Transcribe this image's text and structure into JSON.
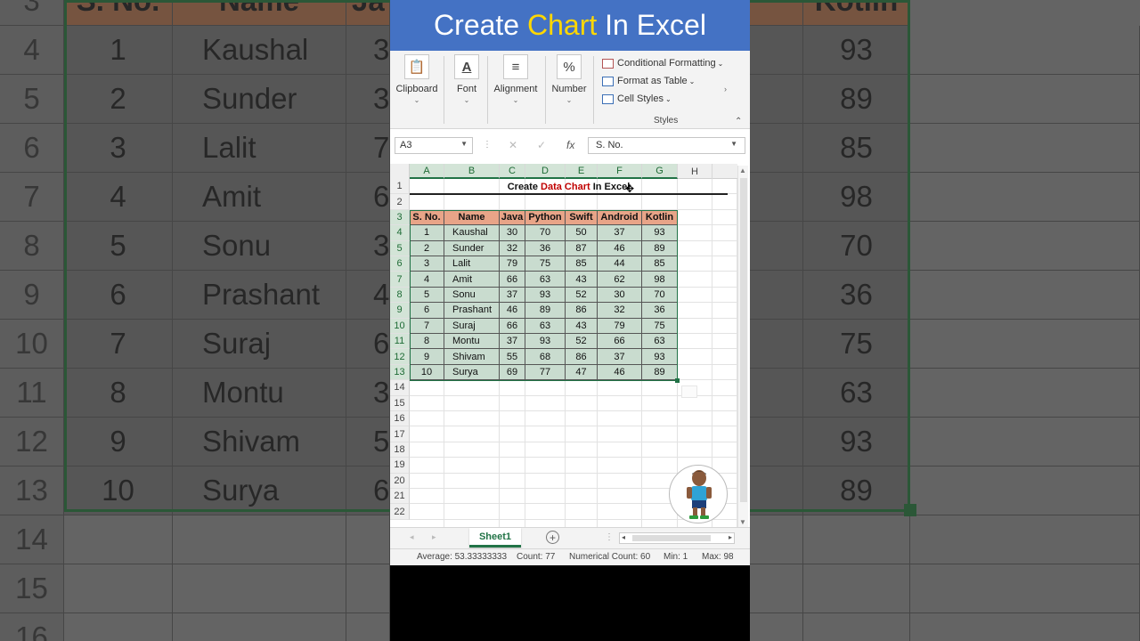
{
  "banner": {
    "prefix": "Create ",
    "highlight": "Chart",
    "suffix": " In Excel"
  },
  "ribbon": {
    "groups": [
      {
        "label": "Clipboard",
        "icon": "clipboard-icon"
      },
      {
        "label": "Font",
        "icon": "font-color-icon"
      },
      {
        "label": "Alignment",
        "icon": "align-icon"
      },
      {
        "label": "Number",
        "icon": "percent-icon"
      }
    ],
    "styles": {
      "conditional_formatting": "Conditional Formatting",
      "format_as_table": "Format as Table",
      "cell_styles": "Cell Styles",
      "group_label": "Styles"
    }
  },
  "formula_bar": {
    "name_box": "A3",
    "content": "S. No."
  },
  "columns": [
    "A",
    "B",
    "C",
    "D",
    "E",
    "F",
    "G",
    "H"
  ],
  "rows": [
    "1",
    "2",
    "3",
    "4",
    "5",
    "6",
    "7",
    "8",
    "9",
    "10",
    "11",
    "12",
    "13",
    "14",
    "15",
    "16",
    "17",
    "18",
    "19",
    "20",
    "21",
    "22"
  ],
  "sheet_title": {
    "prefix": "Create ",
    "highlight": "Data Chart",
    "suffix": " In Excel"
  },
  "table": {
    "headers": [
      "S. No.",
      "Name",
      "Java",
      "Python",
      "Swift",
      "Android",
      "Kotlin"
    ],
    "rows": [
      [
        "1",
        "Kaushal",
        "30",
        "70",
        "50",
        "37",
        "93"
      ],
      [
        "2",
        "Sunder",
        "32",
        "36",
        "87",
        "46",
        "89"
      ],
      [
        "3",
        "Lalit",
        "79",
        "75",
        "85",
        "44",
        "85"
      ],
      [
        "4",
        "Amit",
        "66",
        "63",
        "43",
        "62",
        "98"
      ],
      [
        "5",
        "Sonu",
        "37",
        "93",
        "52",
        "30",
        "70"
      ],
      [
        "6",
        "Prashant",
        "46",
        "89",
        "86",
        "32",
        "36"
      ],
      [
        "7",
        "Suraj",
        "66",
        "63",
        "43",
        "79",
        "75"
      ],
      [
        "8",
        "Montu",
        "37",
        "93",
        "52",
        "66",
        "63"
      ],
      [
        "9",
        "Shivam",
        "55",
        "68",
        "86",
        "37",
        "93"
      ],
      [
        "10",
        "Surya",
        "69",
        "77",
        "47",
        "46",
        "89"
      ]
    ]
  },
  "background": {
    "row_numbers": [
      "3",
      "4",
      "5",
      "6",
      "7",
      "8",
      "9",
      "10",
      "11",
      "12",
      "13",
      "14",
      "15",
      "16"
    ],
    "header_partial": [
      "S. No.",
      "Name",
      "Ja",
      "Kotlin"
    ],
    "rows": [
      [
        "1",
        "Kaushal",
        "3",
        "93"
      ],
      [
        "2",
        "Sunder",
        "3",
        "89"
      ],
      [
        "3",
        "Lalit",
        "7",
        "85"
      ],
      [
        "4",
        "Amit",
        "6",
        "98"
      ],
      [
        "5",
        "Sonu",
        "3",
        "70"
      ],
      [
        "6",
        "Prashant",
        "4",
        "36"
      ],
      [
        "7",
        "Suraj",
        "6",
        "75"
      ],
      [
        "8",
        "Montu",
        "3",
        "63"
      ],
      [
        "9",
        "Shivam",
        "5",
        "93"
      ],
      [
        "10",
        "Surya",
        "6",
        "89"
      ]
    ]
  },
  "tabs": {
    "sheet": "Sheet1"
  },
  "status": {
    "average": "Average: 53.33333333",
    "count": "Count: 77",
    "numerical_count": "Numerical Count: 60",
    "min": "Min: 1",
    "max": "Max: 98"
  },
  "colors": {
    "banner": "#4472c4",
    "header_fill": "#e8a488",
    "accent": "#217346",
    "highlight": "#c00000"
  }
}
